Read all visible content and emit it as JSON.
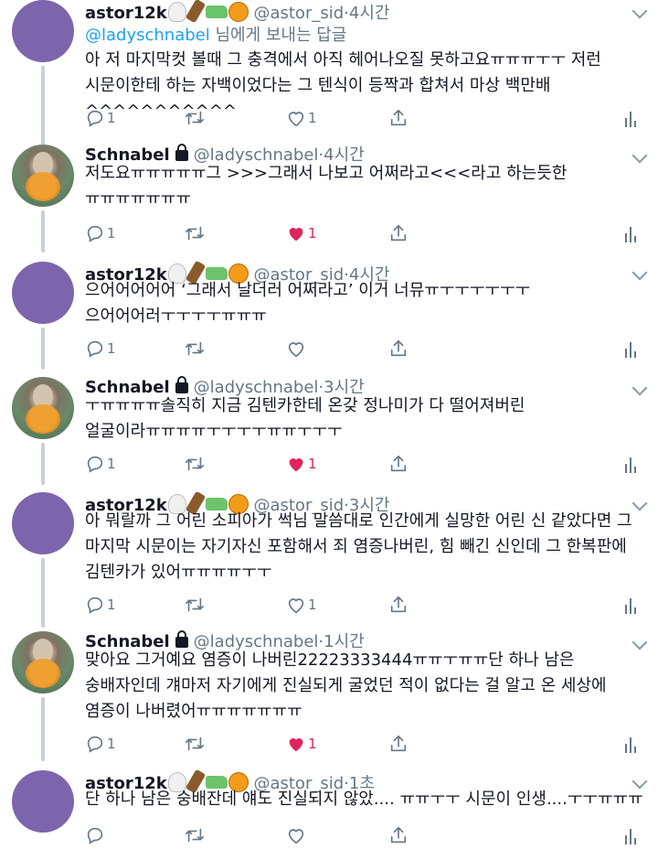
{
  "tweets": [
    {
      "kind": "astor",
      "name": "astor12k",
      "handle": "@astor_sid",
      "time": "·4시간",
      "reply_link": "@ladyschnabel",
      "reply_suffix": " 님에게 보내는 답글",
      "text": "아 저 마지막컷 볼때 그 충격에서 아직 헤어나오질 못하고요ㅠㅠㅠㅜㅜ 저런\n시문이한테 하는 자백이었다는 그 텐식이 등짝과 합쳐서 마상 백만배^^^^^^^^^^^",
      "reply_count": "1",
      "like_count": "1",
      "liked": false
    },
    {
      "kind": "schnabel",
      "name": "Schnabel",
      "handle": "@ladyschnabel",
      "time": "·4시간",
      "text": "저도요ㅠㅠㅠㅠㅠ그 >>>그래서 나보고 어쩌라고<<<라고 하는듯한\nㅠㅠㅠㅠㅠㅠㅠ",
      "reply_count": "1",
      "like_count": "1",
      "liked": true
    },
    {
      "kind": "astor",
      "name": "astor12k",
      "handle": "@astor_sid",
      "time": "·4시간",
      "text": "으어어어어어 ‘그래서 날더러 어쩌라고’ 이거 너뮤ㅠㅜㅜㅜㅜㅜㅜ\n으어어어러ㅜㅜㅜㅜㅠㅠㅠ",
      "reply_count": "1",
      "like_count": "",
      "liked": false
    },
    {
      "kind": "schnabel",
      "name": "Schnabel",
      "handle": "@ladyschnabel",
      "time": "·3시간",
      "text": "ㅜㅠㅠㅠㅠ솔직히 지금 김텐카한테 온갖 정나미가 다 떨어져버린\n얼굴이라ㅠㅠㅠㅠㅜㅜㅜㅜㅠㅠㅜㅜㅜ",
      "reply_count": "1",
      "like_count": "1",
      "liked": true
    },
    {
      "kind": "astor",
      "name": "astor12k",
      "handle": "@astor_sid",
      "time": "·3시간",
      "text": "아 뭐랄까 그 어린 소피아가 썩님 말씀대로 인간에게 실망한 어린 신 같았다면 그\n마지막 시문이는 자기자신 포함해서 죄 염증나버린, 힘 빼긴 신인데 그 한복판에\n김텐카가 있어ㅠㅠㅠㅠㅜㅜ",
      "reply_count": "1",
      "like_count": "1",
      "liked": false
    },
    {
      "kind": "schnabel",
      "name": "Schnabel",
      "handle": "@ladyschnabel",
      "time": "·1시간",
      "text": "맞아요 그거예요 염증이 나버린22223333444ㅠㅠㅜㅠㅠ단 하나 남은\n숭배자인데 걔마저 자기에게 진실되게 굴었던 적이 없다는 걸 알고 온 세상에\n염증이 나버렸어ㅠㅠㅠㅠㅠㅠㅠ",
      "reply_count": "1",
      "like_count": "1",
      "liked": true
    },
    {
      "kind": "astor",
      "name": "astor12k",
      "handle": "@astor_sid",
      "time": "·1초",
      "text": "단 하나 남은 숭배잔데 얘도 진실되지 않았.... ㅠㅠㅜㅜ 시문이 인생....ㅜㅜㅠㅠㅠ",
      "reply_count": "",
      "like_count": "",
      "liked": false
    }
  ],
  "icons": {
    "reply": "reply-icon",
    "retweet": "retweet-icon",
    "like": "heart-icon",
    "share": "share-icon",
    "analytics": "analytics-icon",
    "lock": "lock-icon",
    "menu": "chevron-down-icon"
  },
  "colors": {
    "link": "#1da1f2",
    "muted": "#657786",
    "like_active": "#e0245e",
    "avatar_purple": "#7d65ad"
  }
}
